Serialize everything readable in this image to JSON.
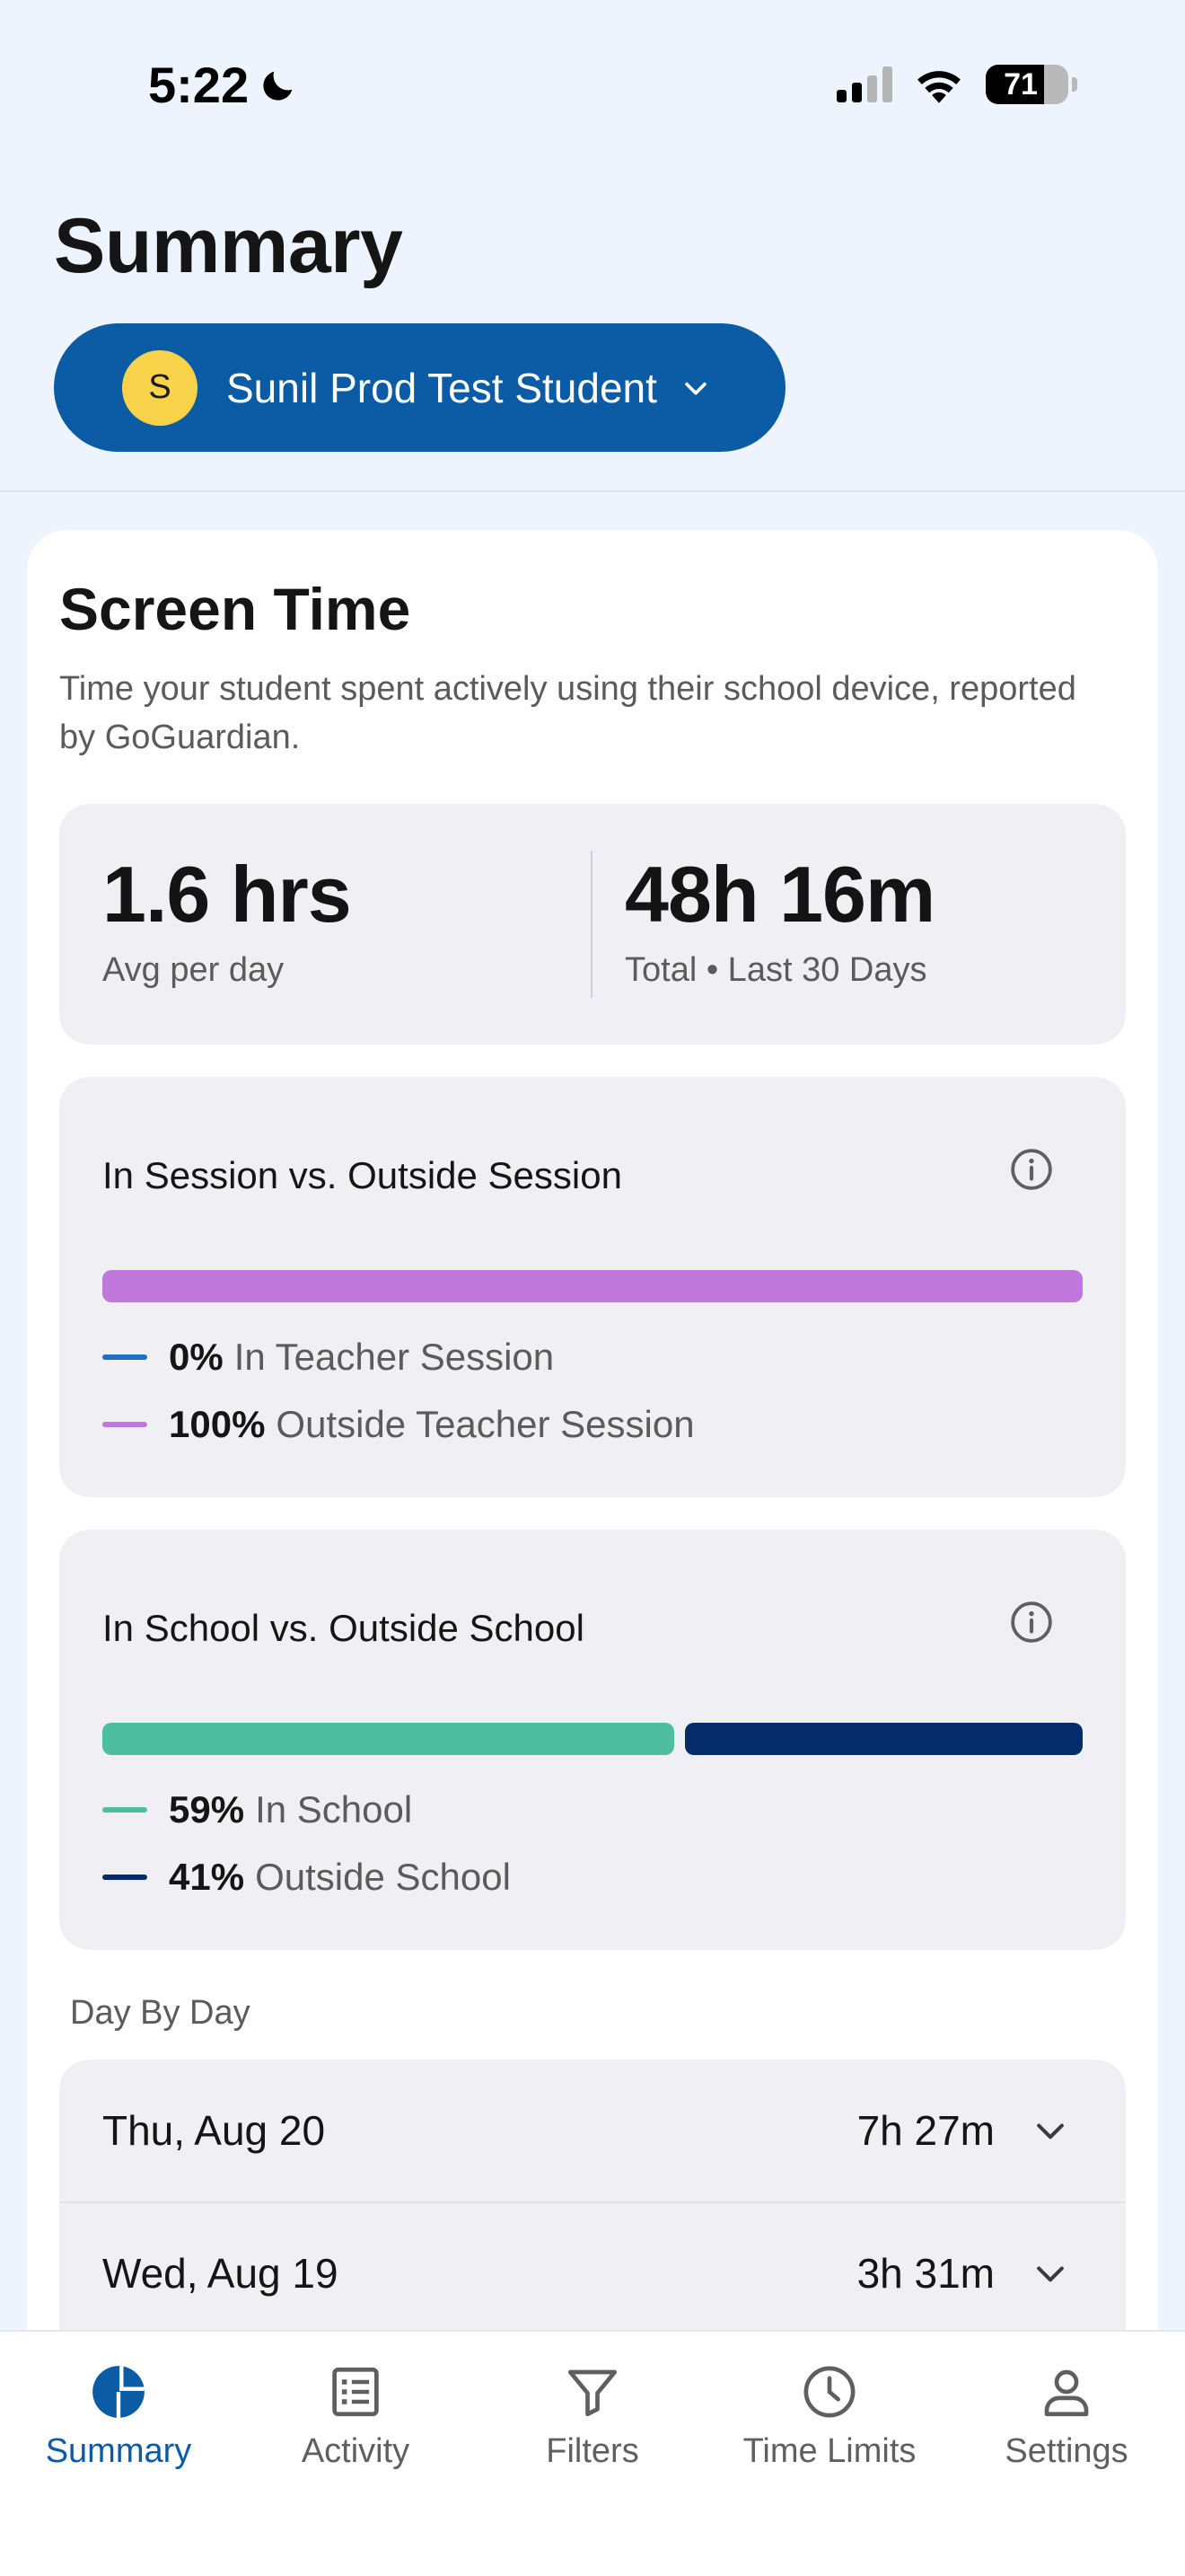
{
  "status_bar": {
    "time": "5:22",
    "battery": "71",
    "battery_fraction": 0.71
  },
  "header": {
    "title": "Summary",
    "student": {
      "initial": "S",
      "name": "Sunil Prod Test Student"
    }
  },
  "screen_time": {
    "title": "Screen Time",
    "description": "Time your student spent actively using their school device, reported by GoGuardian.",
    "avg": {
      "value": "1.6 hrs",
      "label": "Avg per day"
    },
    "total": {
      "value": "48h 16m",
      "label": "Total • Last 30 Days"
    }
  },
  "session_split": {
    "title": "In Session vs. Outside Session",
    "segments": [
      {
        "pct": "0%",
        "label": "In Teacher Session",
        "value": 0,
        "color": "#1F6FC0"
      },
      {
        "pct": "100%",
        "label": "Outside Teacher Session",
        "value": 100,
        "color": "#C077DC"
      }
    ]
  },
  "school_split": {
    "title": "In School vs. Outside School",
    "segments": [
      {
        "pct": "59%",
        "label": "In School",
        "value": 59,
        "color": "#4DBFA0"
      },
      {
        "pct": "41%",
        "label": "Outside School",
        "value": 41,
        "color": "#042C6B"
      }
    ]
  },
  "day_by_day": {
    "title": "Day By Day",
    "days": [
      {
        "date": "Thu, Aug 20",
        "duration": "7h 27m"
      },
      {
        "date": "Wed, Aug 19",
        "duration": "3h 31m"
      }
    ]
  },
  "tabs": [
    {
      "label": "Summary",
      "icon": "pie-chart-icon",
      "active": true
    },
    {
      "label": "Activity",
      "icon": "list-icon",
      "active": false
    },
    {
      "label": "Filters",
      "icon": "filter-icon",
      "active": false
    },
    {
      "label": "Time Limits",
      "icon": "clock-icon",
      "active": false
    },
    {
      "label": "Settings",
      "icon": "person-icon",
      "active": false
    }
  ],
  "colors": {
    "primary": "#0B5BA5",
    "background": "#EEF4FD",
    "avatar": "#F8D34A"
  }
}
